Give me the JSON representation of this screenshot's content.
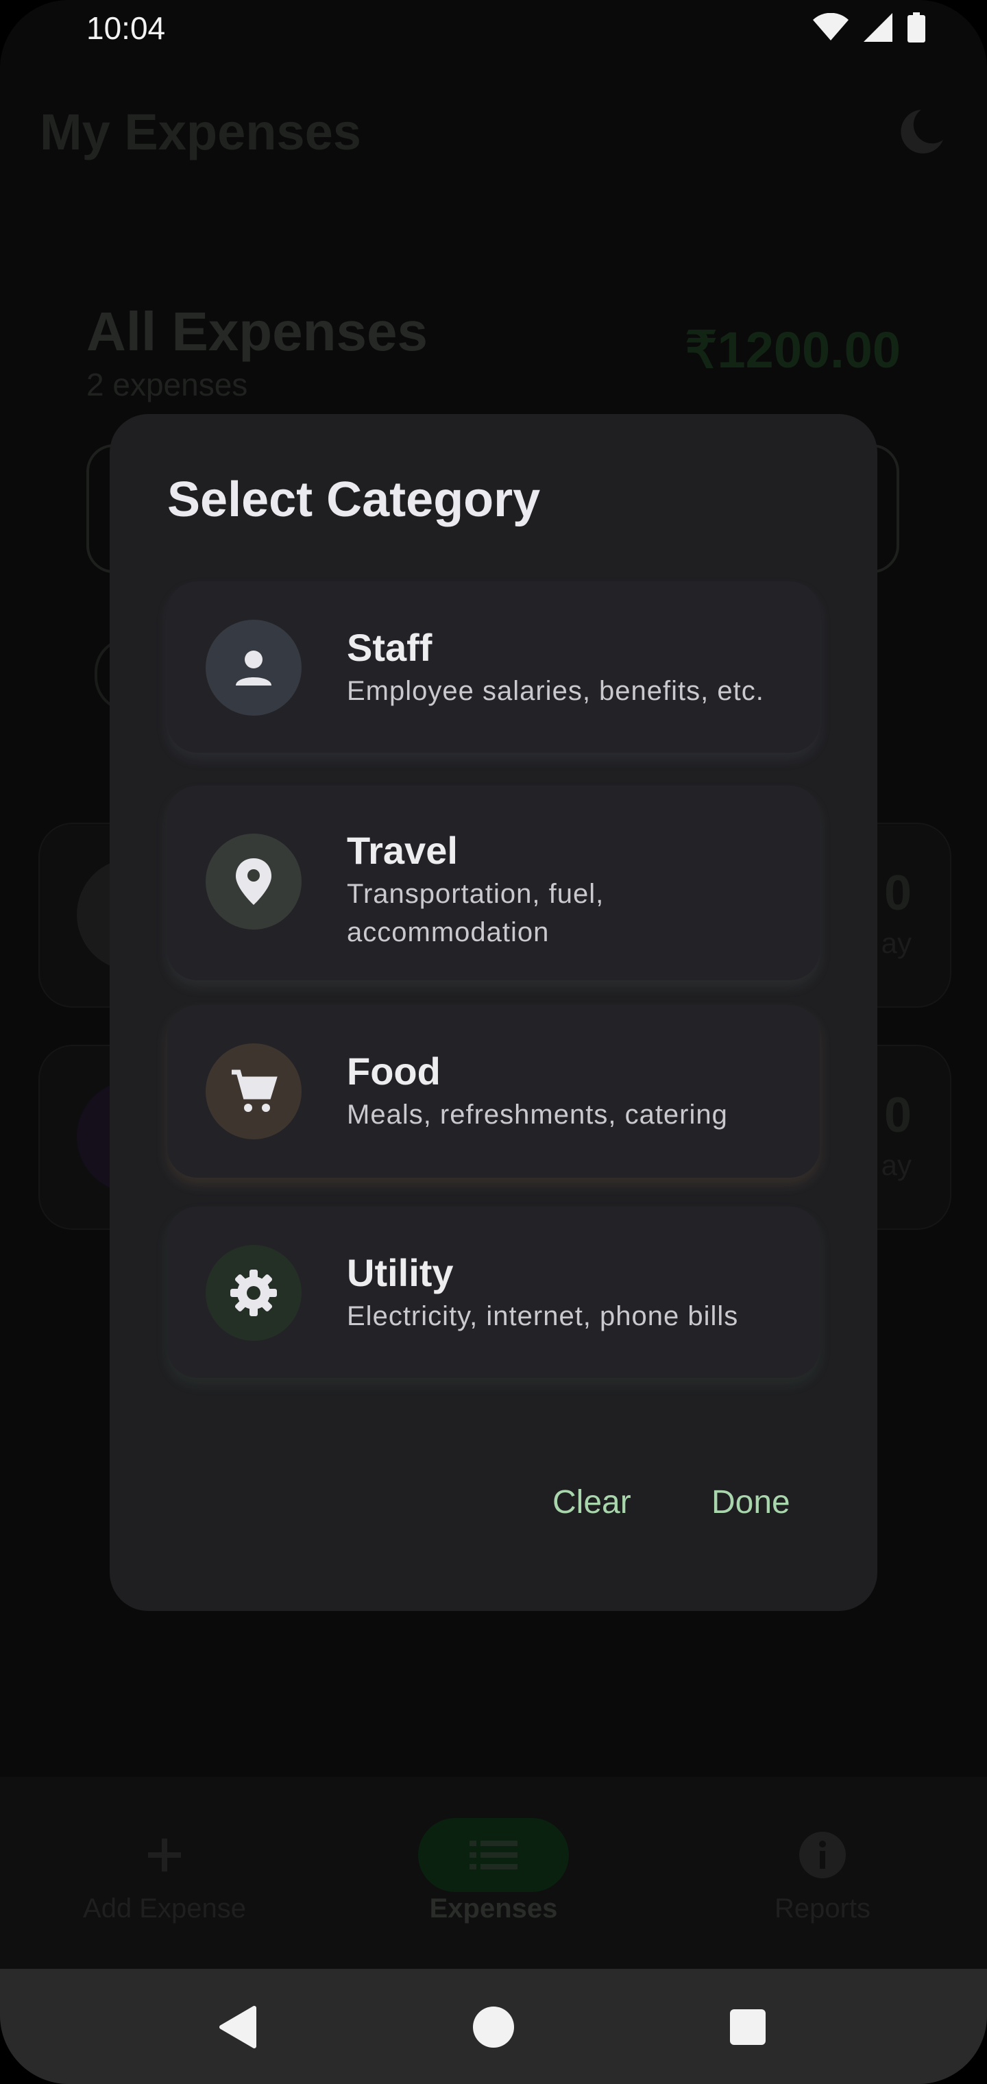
{
  "status_bar": {
    "time": "10:04",
    "icons": [
      "wifi-icon",
      "signal-icon",
      "battery-icon"
    ]
  },
  "app": {
    "title": "My Expenses",
    "summary": {
      "title": "All Expenses",
      "count": "2 expenses",
      "total": "₹1200.00"
    },
    "expenses": [
      {
        "amount_partial": "0",
        "sub_partial": "ay"
      },
      {
        "amount_partial": "0",
        "sub_partial": "ay"
      }
    ]
  },
  "dialog": {
    "title": "Select Category",
    "categories": [
      {
        "name": "Staff",
        "description": "Employee salaries, benefits, etc.",
        "icon": "person-icon"
      },
      {
        "name": "Travel",
        "description": "Transportation, fuel, accommodation",
        "icon": "location-pin-icon"
      },
      {
        "name": "Food",
        "description": "Meals, refreshments, catering",
        "icon": "cart-icon"
      },
      {
        "name": "Utility",
        "description": "Electricity, internet, phone bills",
        "icon": "gear-icon"
      }
    ],
    "clear_label": "Clear",
    "done_label": "Done"
  },
  "bottom_nav": {
    "items": [
      {
        "label": "Add Expense",
        "icon": "plus-icon"
      },
      {
        "label": "Expenses",
        "icon": "list-icon",
        "selected": true
      },
      {
        "label": "Reports",
        "icon": "info-icon"
      }
    ]
  },
  "colors": {
    "accent": "#a9d6ad",
    "dialog_bg": "#1f1f22",
    "card_bg": "#232327"
  }
}
